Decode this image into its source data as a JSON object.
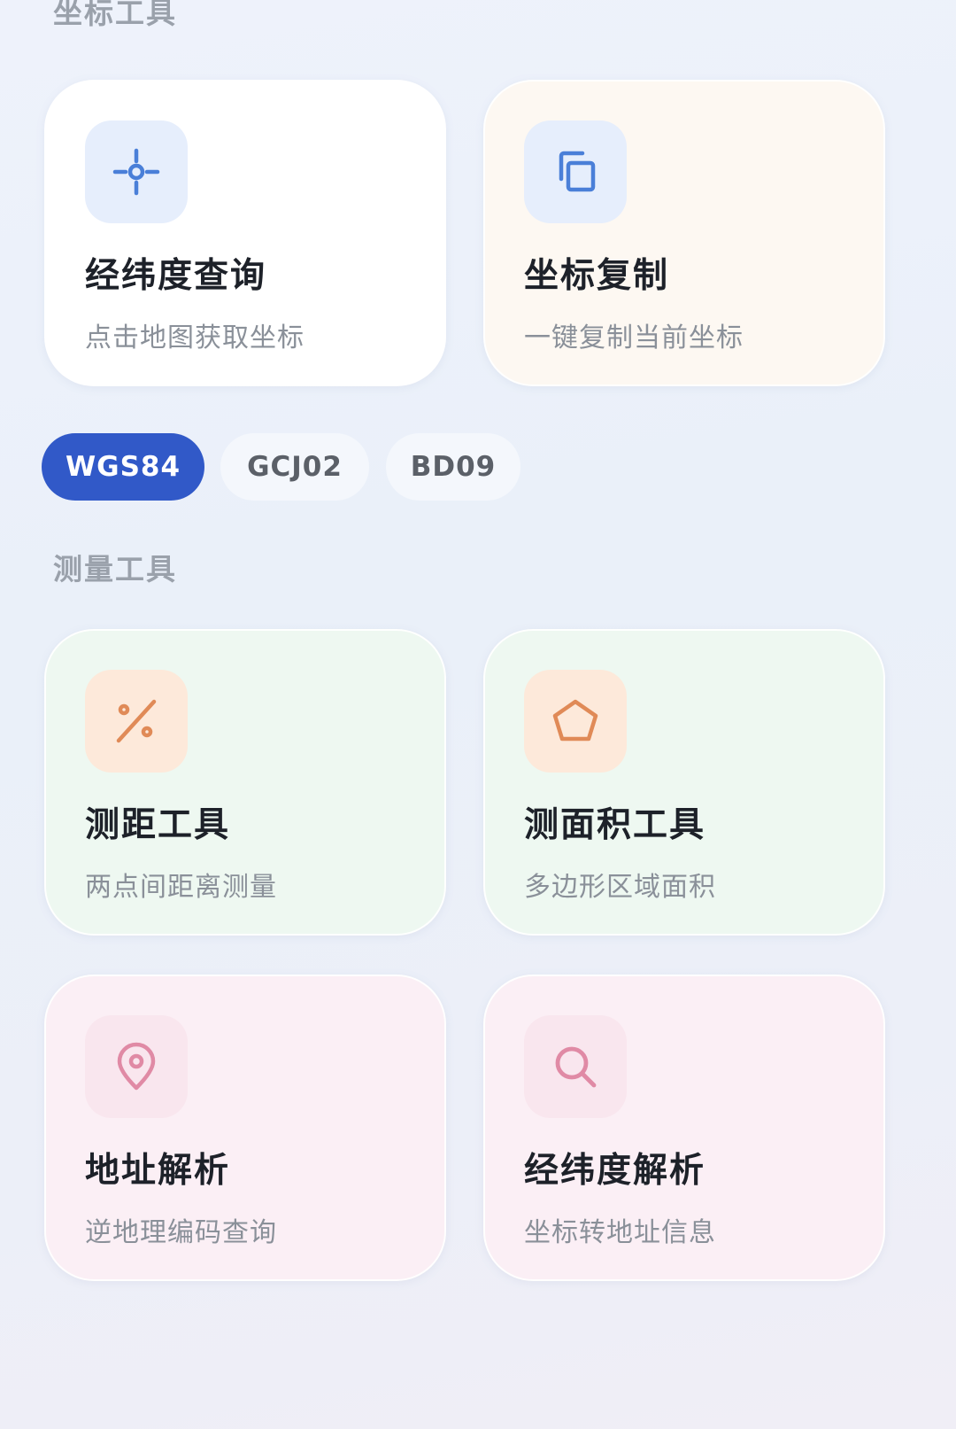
{
  "sections": {
    "coord_tools": "坐标工具",
    "measure_tools": "测量工具"
  },
  "colors": {
    "accent": "#3159c8",
    "icon_blue": "#4a7fd8",
    "icon_orange": "#e08a57",
    "icon_pink": "#e08aa5"
  },
  "cards": {
    "latlng_query": {
      "title": "经纬度查询",
      "desc": "点击地图获取坐标",
      "icon": "crosshair-icon"
    },
    "coord_copy": {
      "title": "坐标复制",
      "desc": "一键复制当前坐标",
      "icon": "copy-icon"
    },
    "distance": {
      "title": "测距工具",
      "desc": "两点间距离测量",
      "icon": "percent-icon"
    },
    "area": {
      "title": "测面积工具",
      "desc": "多边形区域面积",
      "icon": "pentagon-icon"
    },
    "address": {
      "title": "地址解析",
      "desc": "逆地理编码查询",
      "icon": "location-pin-icon"
    },
    "latlng_parse": {
      "title": "经纬度解析",
      "desc": "坐标转地址信息",
      "icon": "search-icon"
    }
  },
  "coord_systems": {
    "selected": "WGS84",
    "options": [
      "WGS84",
      "GCJ02",
      "BD09"
    ]
  }
}
